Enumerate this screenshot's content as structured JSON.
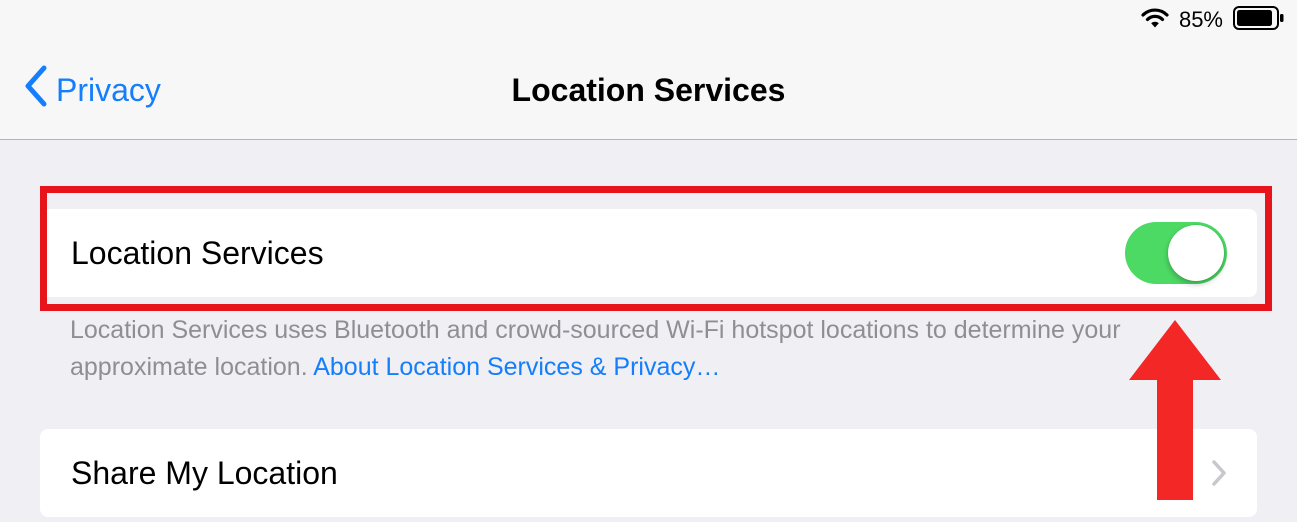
{
  "status_bar": {
    "battery_percent": "85%",
    "battery_level": 0.85
  },
  "nav": {
    "back_label": "Privacy",
    "title": "Location Services"
  },
  "location_services": {
    "label": "Location Services",
    "toggle_on": true,
    "toggle_color": "#4cd964",
    "footer_text": "Location Services uses Bluetooth and crowd-sourced Wi-Fi hotspot locations to determine your approximate location.",
    "footer_link": "About Location Services & Privacy…"
  },
  "share_my_location": {
    "label": "Share My Location"
  },
  "colors": {
    "accent": "#157efb",
    "highlight": "#e8141c",
    "background": "#efeff4"
  }
}
